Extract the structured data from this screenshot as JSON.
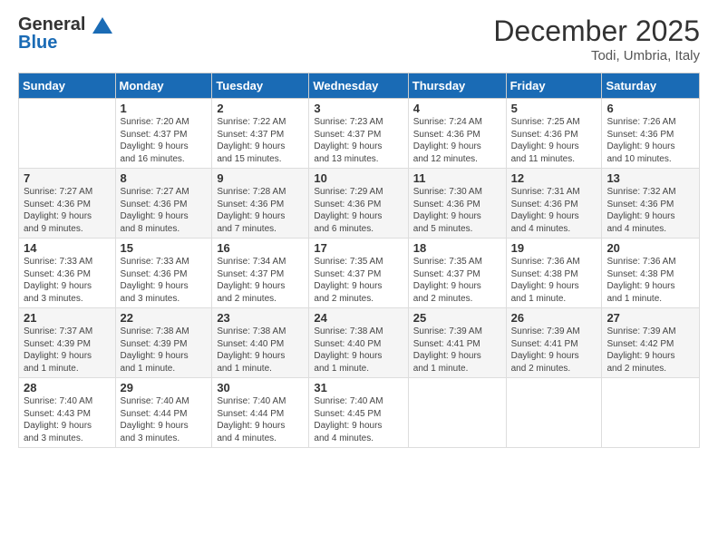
{
  "header": {
    "logo_general": "General",
    "logo_blue": "Blue",
    "month_title": "December 2025",
    "location": "Todi, Umbria, Italy"
  },
  "days_of_week": [
    "Sunday",
    "Monday",
    "Tuesday",
    "Wednesday",
    "Thursday",
    "Friday",
    "Saturday"
  ],
  "weeks": [
    [
      {
        "num": "",
        "lines": []
      },
      {
        "num": "1",
        "lines": [
          "Sunrise: 7:20 AM",
          "Sunset: 4:37 PM",
          "Daylight: 9 hours",
          "and 16 minutes."
        ]
      },
      {
        "num": "2",
        "lines": [
          "Sunrise: 7:22 AM",
          "Sunset: 4:37 PM",
          "Daylight: 9 hours",
          "and 15 minutes."
        ]
      },
      {
        "num": "3",
        "lines": [
          "Sunrise: 7:23 AM",
          "Sunset: 4:37 PM",
          "Daylight: 9 hours",
          "and 13 minutes."
        ]
      },
      {
        "num": "4",
        "lines": [
          "Sunrise: 7:24 AM",
          "Sunset: 4:36 PM",
          "Daylight: 9 hours",
          "and 12 minutes."
        ]
      },
      {
        "num": "5",
        "lines": [
          "Sunrise: 7:25 AM",
          "Sunset: 4:36 PM",
          "Daylight: 9 hours",
          "and 11 minutes."
        ]
      },
      {
        "num": "6",
        "lines": [
          "Sunrise: 7:26 AM",
          "Sunset: 4:36 PM",
          "Daylight: 9 hours",
          "and 10 minutes."
        ]
      }
    ],
    [
      {
        "num": "7",
        "lines": [
          "Sunrise: 7:27 AM",
          "Sunset: 4:36 PM",
          "Daylight: 9 hours",
          "and 9 minutes."
        ]
      },
      {
        "num": "8",
        "lines": [
          "Sunrise: 7:27 AM",
          "Sunset: 4:36 PM",
          "Daylight: 9 hours",
          "and 8 minutes."
        ]
      },
      {
        "num": "9",
        "lines": [
          "Sunrise: 7:28 AM",
          "Sunset: 4:36 PM",
          "Daylight: 9 hours",
          "and 7 minutes."
        ]
      },
      {
        "num": "10",
        "lines": [
          "Sunrise: 7:29 AM",
          "Sunset: 4:36 PM",
          "Daylight: 9 hours",
          "and 6 minutes."
        ]
      },
      {
        "num": "11",
        "lines": [
          "Sunrise: 7:30 AM",
          "Sunset: 4:36 PM",
          "Daylight: 9 hours",
          "and 5 minutes."
        ]
      },
      {
        "num": "12",
        "lines": [
          "Sunrise: 7:31 AM",
          "Sunset: 4:36 PM",
          "Daylight: 9 hours",
          "and 4 minutes."
        ]
      },
      {
        "num": "13",
        "lines": [
          "Sunrise: 7:32 AM",
          "Sunset: 4:36 PM",
          "Daylight: 9 hours",
          "and 4 minutes."
        ]
      }
    ],
    [
      {
        "num": "14",
        "lines": [
          "Sunrise: 7:33 AM",
          "Sunset: 4:36 PM",
          "Daylight: 9 hours",
          "and 3 minutes."
        ]
      },
      {
        "num": "15",
        "lines": [
          "Sunrise: 7:33 AM",
          "Sunset: 4:36 PM",
          "Daylight: 9 hours",
          "and 3 minutes."
        ]
      },
      {
        "num": "16",
        "lines": [
          "Sunrise: 7:34 AM",
          "Sunset: 4:37 PM",
          "Daylight: 9 hours",
          "and 2 minutes."
        ]
      },
      {
        "num": "17",
        "lines": [
          "Sunrise: 7:35 AM",
          "Sunset: 4:37 PM",
          "Daylight: 9 hours",
          "and 2 minutes."
        ]
      },
      {
        "num": "18",
        "lines": [
          "Sunrise: 7:35 AM",
          "Sunset: 4:37 PM",
          "Daylight: 9 hours",
          "and 2 minutes."
        ]
      },
      {
        "num": "19",
        "lines": [
          "Sunrise: 7:36 AM",
          "Sunset: 4:38 PM",
          "Daylight: 9 hours",
          "and 1 minute."
        ]
      },
      {
        "num": "20",
        "lines": [
          "Sunrise: 7:36 AM",
          "Sunset: 4:38 PM",
          "Daylight: 9 hours",
          "and 1 minute."
        ]
      }
    ],
    [
      {
        "num": "21",
        "lines": [
          "Sunrise: 7:37 AM",
          "Sunset: 4:39 PM",
          "Daylight: 9 hours",
          "and 1 minute."
        ]
      },
      {
        "num": "22",
        "lines": [
          "Sunrise: 7:38 AM",
          "Sunset: 4:39 PM",
          "Daylight: 9 hours",
          "and 1 minute."
        ]
      },
      {
        "num": "23",
        "lines": [
          "Sunrise: 7:38 AM",
          "Sunset: 4:40 PM",
          "Daylight: 9 hours",
          "and 1 minute."
        ]
      },
      {
        "num": "24",
        "lines": [
          "Sunrise: 7:38 AM",
          "Sunset: 4:40 PM",
          "Daylight: 9 hours",
          "and 1 minute."
        ]
      },
      {
        "num": "25",
        "lines": [
          "Sunrise: 7:39 AM",
          "Sunset: 4:41 PM",
          "Daylight: 9 hours",
          "and 1 minute."
        ]
      },
      {
        "num": "26",
        "lines": [
          "Sunrise: 7:39 AM",
          "Sunset: 4:41 PM",
          "Daylight: 9 hours",
          "and 2 minutes."
        ]
      },
      {
        "num": "27",
        "lines": [
          "Sunrise: 7:39 AM",
          "Sunset: 4:42 PM",
          "Daylight: 9 hours",
          "and 2 minutes."
        ]
      }
    ],
    [
      {
        "num": "28",
        "lines": [
          "Sunrise: 7:40 AM",
          "Sunset: 4:43 PM",
          "Daylight: 9 hours",
          "and 3 minutes."
        ]
      },
      {
        "num": "29",
        "lines": [
          "Sunrise: 7:40 AM",
          "Sunset: 4:44 PM",
          "Daylight: 9 hours",
          "and 3 minutes."
        ]
      },
      {
        "num": "30",
        "lines": [
          "Sunrise: 7:40 AM",
          "Sunset: 4:44 PM",
          "Daylight: 9 hours",
          "and 4 minutes."
        ]
      },
      {
        "num": "31",
        "lines": [
          "Sunrise: 7:40 AM",
          "Sunset: 4:45 PM",
          "Daylight: 9 hours",
          "and 4 minutes."
        ]
      },
      {
        "num": "",
        "lines": []
      },
      {
        "num": "",
        "lines": []
      },
      {
        "num": "",
        "lines": []
      }
    ]
  ]
}
